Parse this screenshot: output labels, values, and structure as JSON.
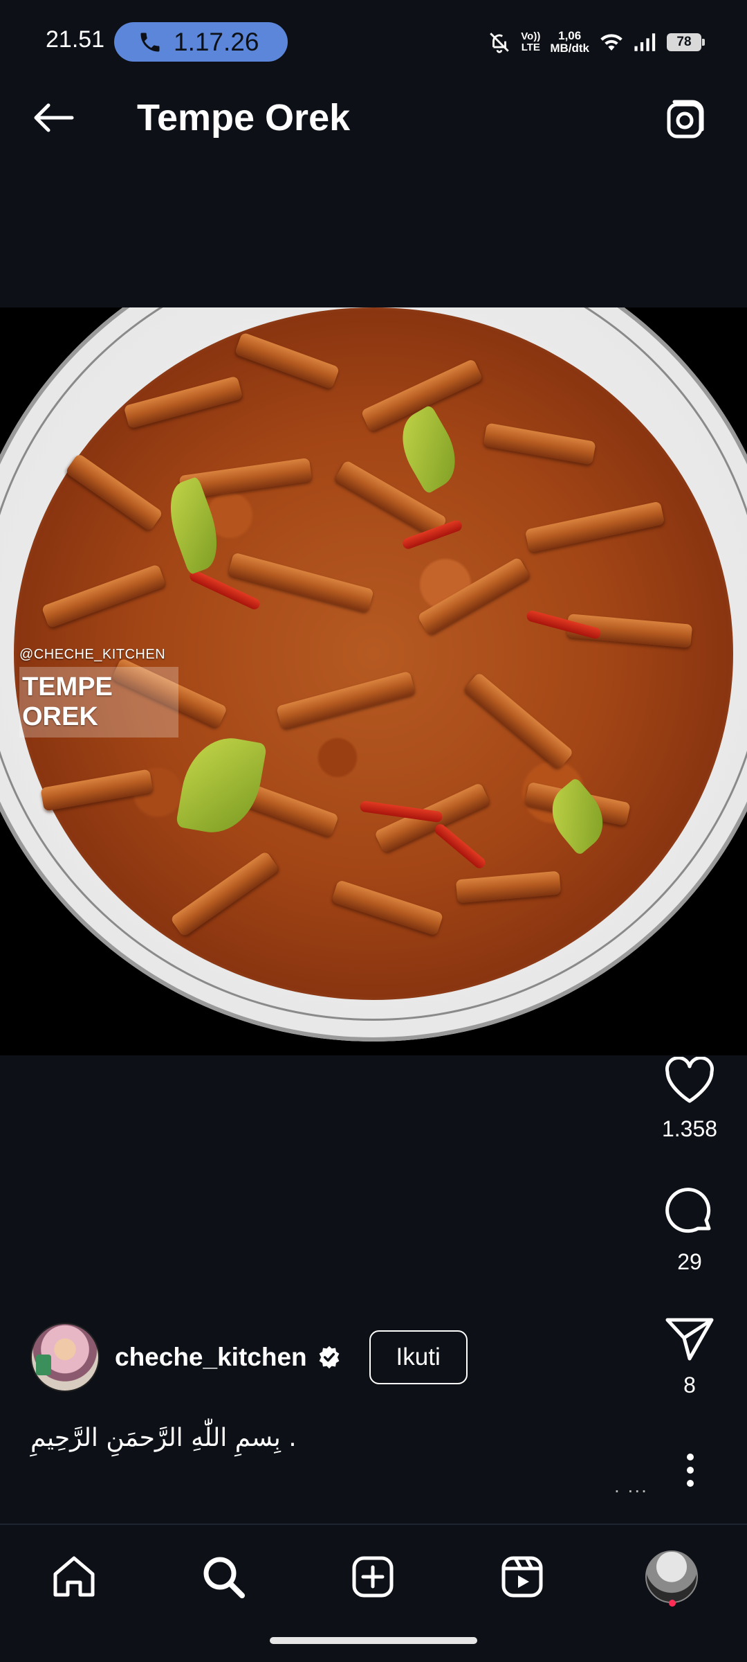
{
  "status_bar": {
    "time": "21.51",
    "call_timer": "1.17.26",
    "volte": "VoLTE",
    "volte_top": "Vo))",
    "volte_bottom": "LTE",
    "net_speed_value": "1,06",
    "net_speed_unit": "MB/dtk",
    "battery": "78"
  },
  "header": {
    "title": "Tempe Orek"
  },
  "post": {
    "watermark_handle": "@CHECHE_KITCHEN",
    "watermark_title": "TEMPE OREK",
    "likes": "1.358",
    "comments": "29",
    "shares": "8",
    "author": "cheche_kitchen",
    "follow_label": "Ikuti",
    "caption": "بِسمِ اللّٰهِ الرَّحمَنِ الرَّحِيمِ .",
    "caption_more": ". ..."
  },
  "icons": {
    "back": "arrow-left-icon",
    "camera": "camera-icon",
    "like": "heart-icon",
    "comment": "comment-icon",
    "share": "send-icon",
    "more": "more-vertical-icon",
    "home": "home-icon",
    "search": "search-icon",
    "create": "plus-square-icon",
    "reels": "reels-icon",
    "profile": "profile-avatar"
  },
  "colors": {
    "background": "#0d1117",
    "call_pill": "#5b86d9",
    "notification_dot": "#ff2d55",
    "verified": "#ffffff"
  }
}
